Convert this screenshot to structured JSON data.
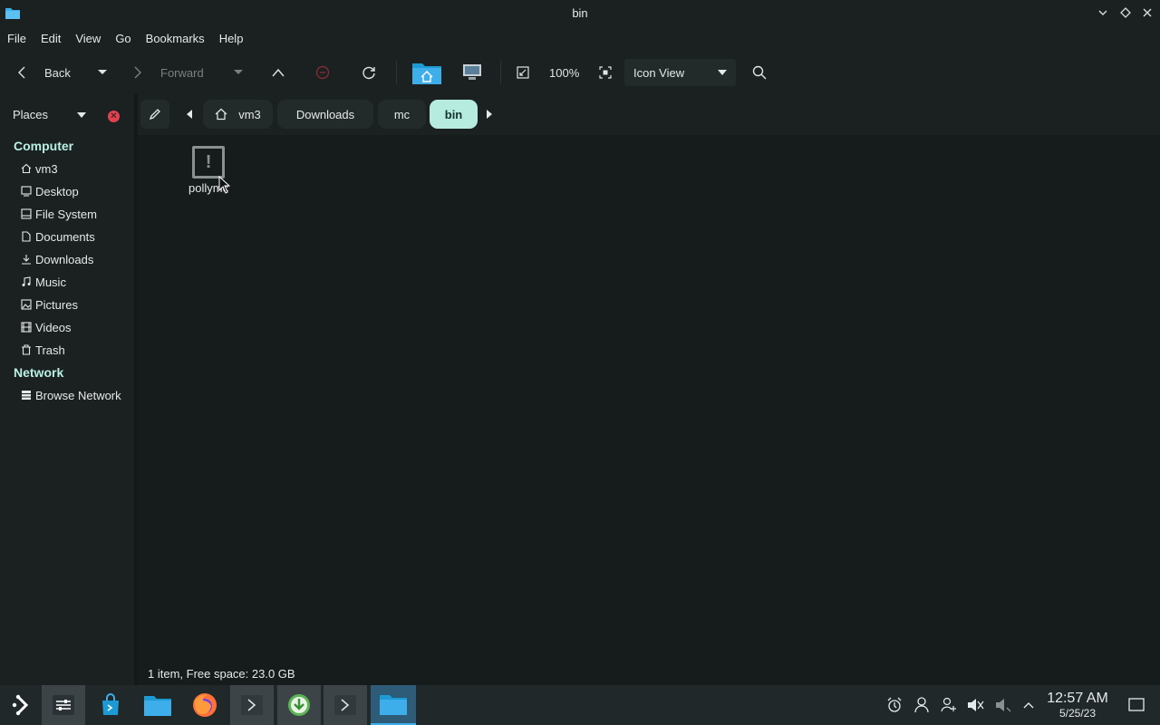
{
  "window": {
    "title": "bin"
  },
  "menu": [
    "File",
    "Edit",
    "View",
    "Go",
    "Bookmarks",
    "Help"
  ],
  "toolbar": {
    "back_label": "Back",
    "forward_label": "Forward",
    "zoom": "100%",
    "view_mode": "Icon View"
  },
  "places": {
    "label": "Places",
    "computer_heading": "Computer",
    "network_heading": "Network",
    "items": [
      {
        "label": "vm3",
        "icon": "home-icon"
      },
      {
        "label": "Desktop",
        "icon": "desktop-icon"
      },
      {
        "label": "File System",
        "icon": "drive-icon"
      },
      {
        "label": "Documents",
        "icon": "document-icon"
      },
      {
        "label": "Downloads",
        "icon": "download-icon"
      },
      {
        "label": "Music",
        "icon": "music-icon"
      },
      {
        "label": "Pictures",
        "icon": "picture-icon"
      },
      {
        "label": "Videos",
        "icon": "video-icon"
      },
      {
        "label": "Trash",
        "icon": "trash-icon"
      }
    ],
    "network_items": [
      {
        "label": "Browse Network",
        "icon": "network-icon"
      }
    ]
  },
  "breadcrumb": [
    "vm3",
    "Downloads",
    "mc",
    "bin"
  ],
  "files": [
    {
      "name": "pollymc",
      "icon": "unknown-file-icon"
    }
  ],
  "status": {
    "text": "1 item, Free space: 23.0 GB"
  },
  "taskbar": {
    "clock_time": "12:57 AM",
    "clock_date": "5/25/23"
  },
  "colors": {
    "accent": "#3daee9",
    "active_crumb": "#b6ebe0",
    "section_heading": "#b9f0e4",
    "close_red": "#e0424f"
  }
}
